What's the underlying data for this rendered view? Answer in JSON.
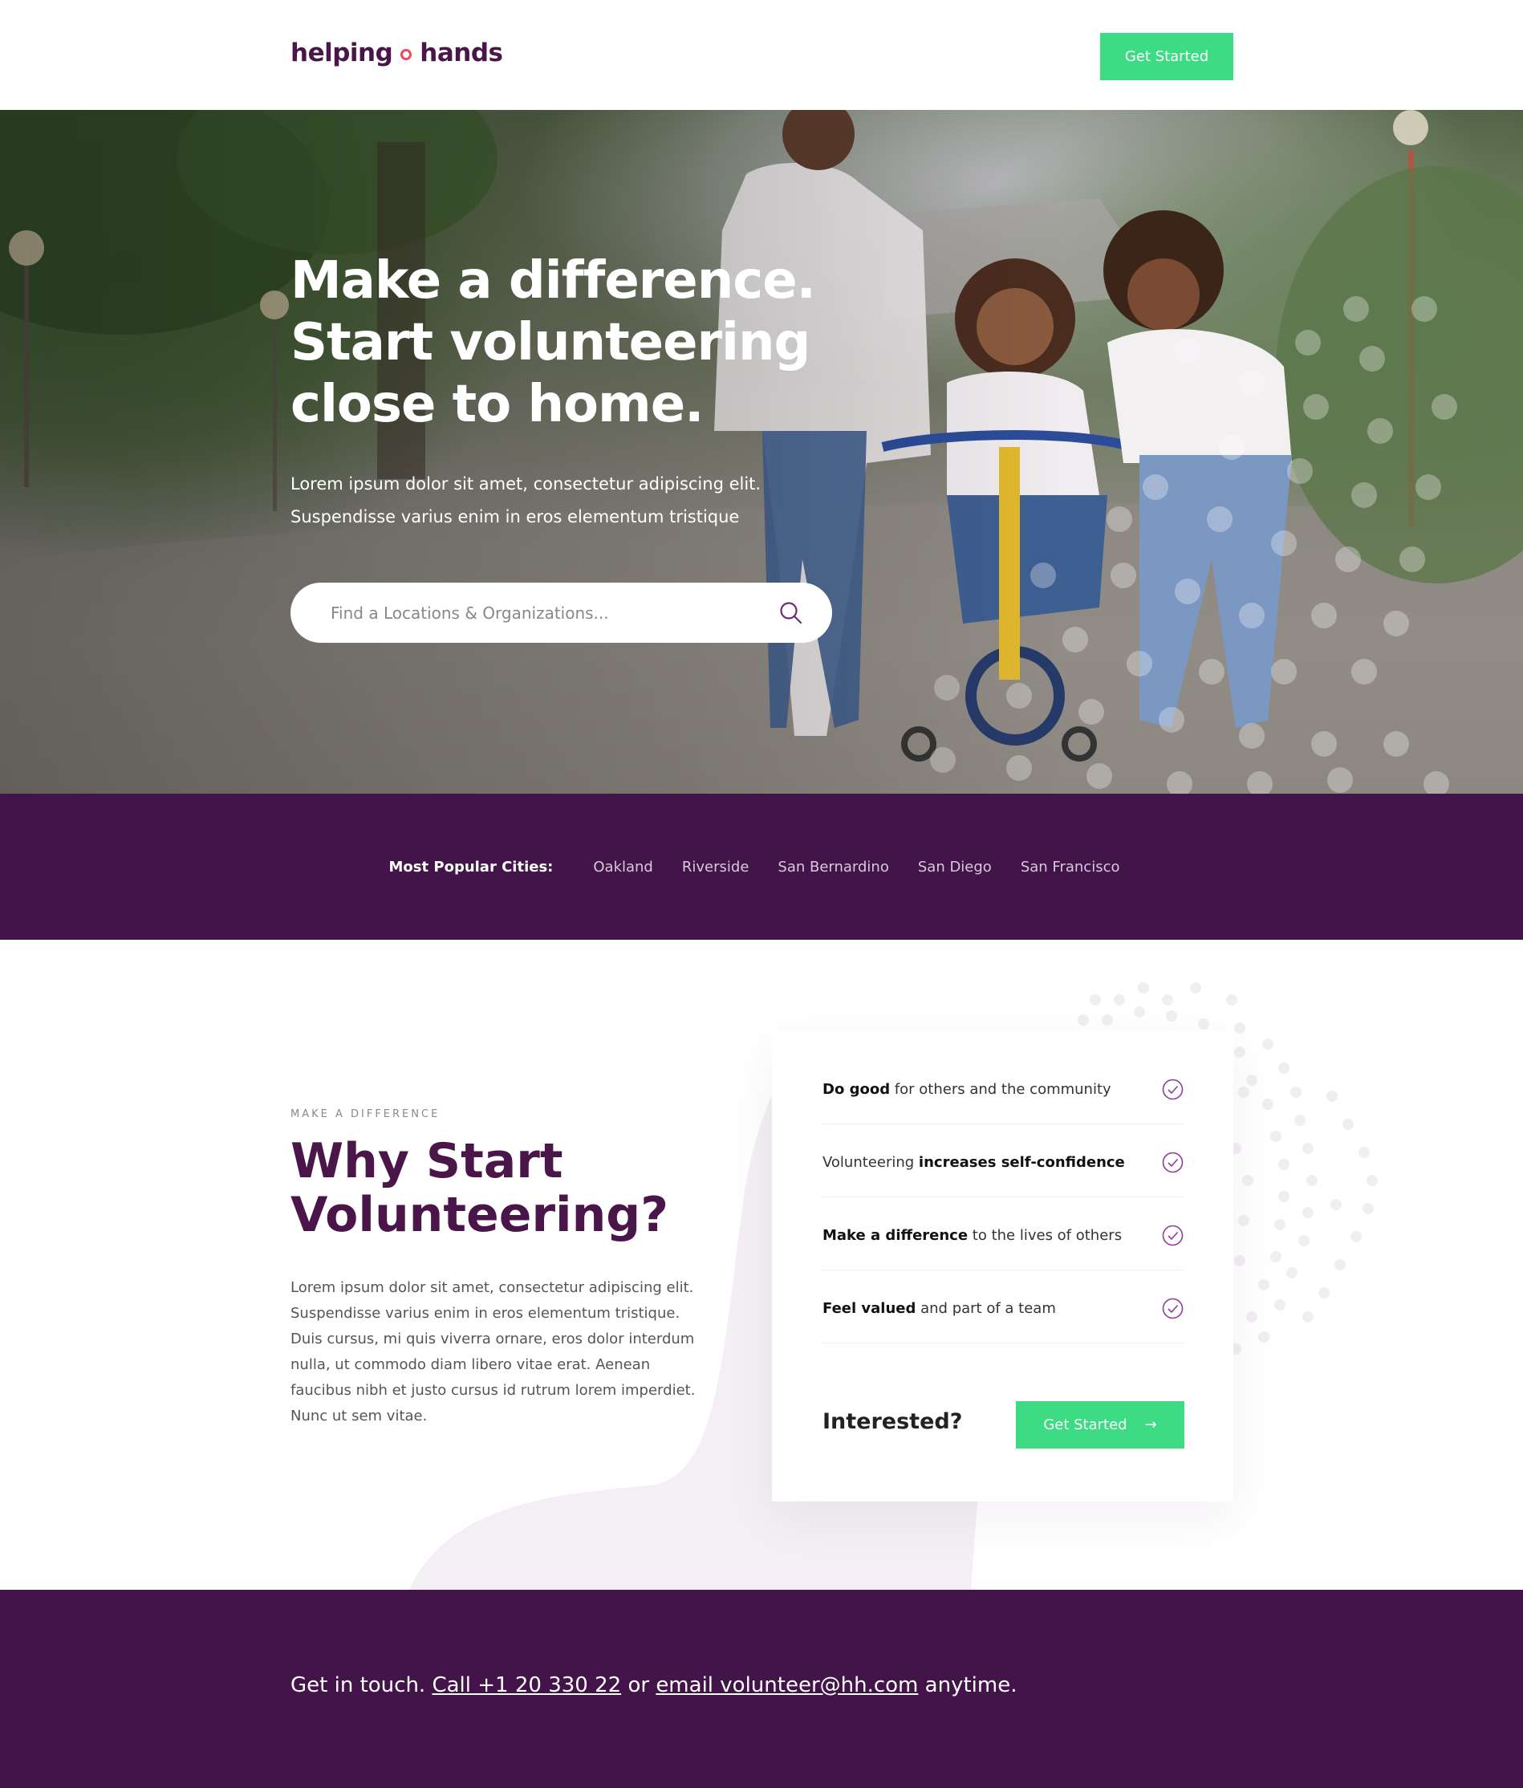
{
  "header": {
    "logo_left": "helping",
    "logo_right": "hands",
    "cta_label": "Get Started"
  },
  "hero": {
    "title_lines": [
      "Make a difference.",
      "Start volunteering",
      "close to home."
    ],
    "subtitle_lines": [
      "Lorem ipsum dolor sit amet, consectetur adipiscing elit.",
      "Suspendisse varius enim in eros elementum tristique"
    ],
    "search": {
      "placeholder": "Find a Locations & Organizations...",
      "value": "",
      "icon": "search-icon"
    }
  },
  "cities": {
    "label": "Most Popular Cities:",
    "items": [
      "Oakland",
      "Riverside",
      "San Bernardino",
      "San Diego",
      "San Francisco"
    ]
  },
  "why": {
    "eyebrow": "MAKE A DIFFERENCE",
    "title_lines": [
      "Why Start",
      "Volunteering?"
    ],
    "body": "Lorem ipsum dolor sit amet, consectetur adipiscing elit. Suspendisse varius enim in eros elementum tristique. Duis cursus, mi quis viverra ornare, eros dolor interdum nulla, ut commodo diam libero vitae erat. Aenean faucibus nibh et justo cursus id rutrum lorem imperdiet. Nunc ut sem vitae.",
    "benefits": [
      {
        "bold_before": "Do good",
        "text": " for others and the community",
        "bold_after": ""
      },
      {
        "bold_before": "",
        "text": "Volunteering ",
        "bold_after": "increases self-confidence"
      },
      {
        "bold_before": "Make a difference",
        "text": " to the lives of others",
        "bold_after": ""
      },
      {
        "bold_before": "Feel valued",
        "text": " and part of a team",
        "bold_after": ""
      }
    ],
    "interested_label": "Interested?",
    "cta_label": "Get Started",
    "cta_arrow": "→"
  },
  "footer": {
    "prefix": "Get in touch.",
    "call_label": "Call +1 20 330 22",
    "middle": "or",
    "email_label": "email volunteer@hh.com",
    "suffix": "anytime."
  },
  "colors": {
    "brand_purple": "#431449",
    "title_purple": "#4a1549",
    "accent_green": "#3ddc84",
    "logo_dot": "#ef4b5c"
  }
}
